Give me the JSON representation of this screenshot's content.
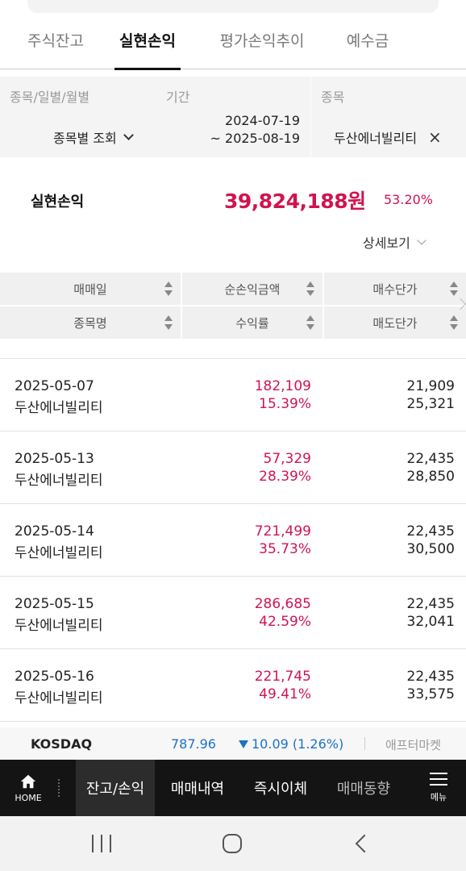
{
  "tabs": [
    {
      "label": "주식잔고"
    },
    {
      "label": "실현손익",
      "active": true
    },
    {
      "label": "평가손익추이"
    },
    {
      "label": "예수금"
    }
  ],
  "filter": {
    "category_label": "종목/일별/월별",
    "period_label": "기간",
    "stock_label": "종목",
    "category_value": "종목별 조회",
    "period_start": "2024-07-19",
    "period_end": "~ 2025-08-19",
    "stock_value": "두산에너빌리티",
    "clear_symbol": "×"
  },
  "summary": {
    "label": "실현손익",
    "amount": "39,824,188원",
    "rate": "53.20%",
    "detail_label": "상세보기"
  },
  "table": {
    "headers_row1": [
      "매매일",
      "순손익금액",
      "매수단가"
    ],
    "headers_row2": [
      "종목명",
      "수익률",
      "매도단가"
    ],
    "rows": [
      {
        "date": "2025-05-07",
        "name": "두산에너빌리티",
        "pnl": "182,109",
        "rate": "15.39%",
        "buy": "21,909",
        "sell": "25,321"
      },
      {
        "date": "2025-05-13",
        "name": "두산에너빌리티",
        "pnl": "57,329",
        "rate": "28.39%",
        "buy": "22,435",
        "sell": "28,850"
      },
      {
        "date": "2025-05-14",
        "name": "두산에너빌리티",
        "pnl": "721,499",
        "rate": "35.73%",
        "buy": "22,435",
        "sell": "30,500"
      },
      {
        "date": "2025-05-15",
        "name": "두산에너빌리티",
        "pnl": "286,685",
        "rate": "42.59%",
        "buy": "22,435",
        "sell": "32,041"
      },
      {
        "date": "2025-05-16",
        "name": "두산에너빌리티",
        "pnl": "221,745",
        "rate": "49.41%",
        "buy": "22,435",
        "sell": "33,575"
      }
    ]
  },
  "ticker": {
    "name": "KOSDAQ",
    "price": "787.96",
    "change": "10.09 (1.26%)",
    "direction_icon": "triangle-down-icon",
    "after_market": "애프터마켓"
  },
  "bottom_nav": {
    "home_label": "HOME",
    "items": [
      {
        "label": "잔고/손익",
        "active": true
      },
      {
        "label": "매매내역"
      },
      {
        "label": "즉시이체"
      },
      {
        "label": "매매동향"
      }
    ],
    "menu_label": "메뉴"
  },
  "colors": {
    "accent_red": "#d0144f",
    "down_blue": "#1a73c8",
    "nav_bg": "#141414"
  }
}
